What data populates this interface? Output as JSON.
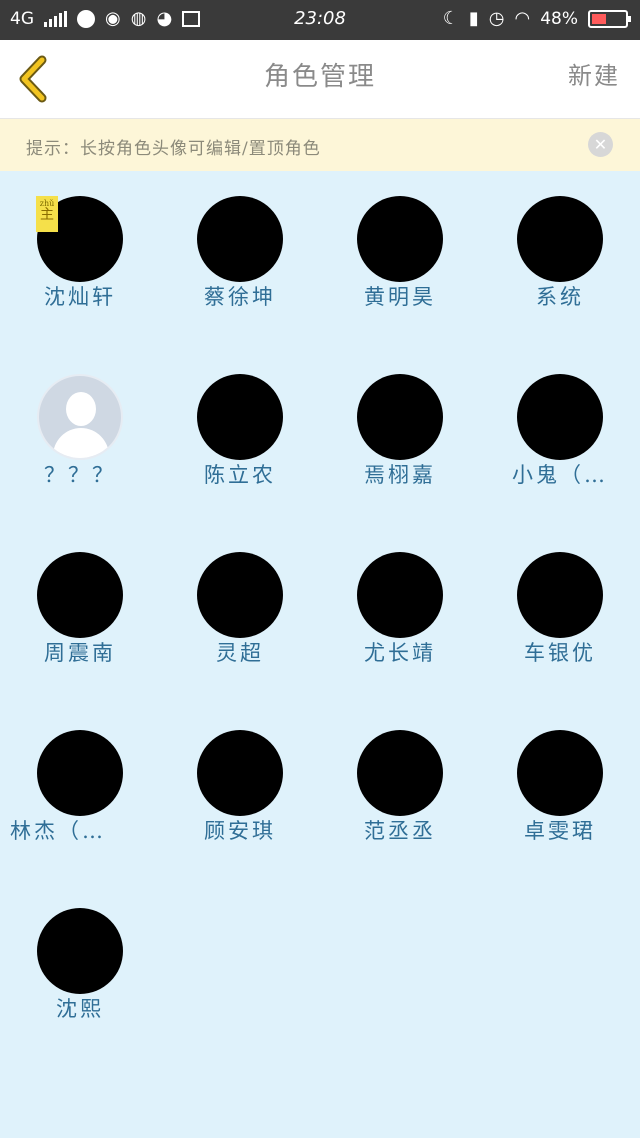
{
  "status_bar": {
    "network": "4G",
    "time": "23:08",
    "battery_percent": "48%",
    "battery_level": 0.48,
    "icons": [
      "signal-icon",
      "browser-icon",
      "weibo-icon",
      "wechat-icon",
      "cat-icon",
      "screenshot-icon",
      "moon-icon",
      "battery-saver-icon",
      "alarm-icon",
      "wifi-icon",
      "battery-icon"
    ]
  },
  "header": {
    "back_icon": "chevron-left-icon",
    "title": "角色管理",
    "new_label": "新建"
  },
  "tip": {
    "text": "提示：长按角色头像可编辑/置顶角色",
    "close_icon": "close-icon"
  },
  "roles": [
    {
      "name": "沈灿轩",
      "badge": "主",
      "default_avatar": false
    },
    {
      "name": "蔡徐坤",
      "default_avatar": false
    },
    {
      "name": "黄明昊",
      "default_avatar": false
    },
    {
      "name": "系统",
      "default_avatar": false
    },
    {
      "name": "？？？",
      "default_avatar": true
    },
    {
      "name": "陈立农",
      "default_avatar": false
    },
    {
      "name": "焉栩嘉",
      "default_avatar": false
    },
    {
      "name": "小鬼（…",
      "default_avatar": false
    },
    {
      "name": "周震南",
      "default_avatar": false
    },
    {
      "name": "灵超",
      "default_avatar": false
    },
    {
      "name": "尤长靖",
      "default_avatar": false
    },
    {
      "name": "车银优",
      "default_avatar": false
    },
    {
      "name": "林杰（…",
      "default_avatar": false
    },
    {
      "name": "顾安琪",
      "default_avatar": false
    },
    {
      "name": "范丞丞",
      "default_avatar": false
    },
    {
      "name": "卓雯珺",
      "default_avatar": false
    },
    {
      "name": "沈熙",
      "default_avatar": false
    }
  ],
  "colors": {
    "background": "#dff2fb",
    "name_text": "#2f6e96",
    "tip_background": "#fdf6d8",
    "back_chevron": "#f2c420",
    "badge": "#f5e04a"
  }
}
